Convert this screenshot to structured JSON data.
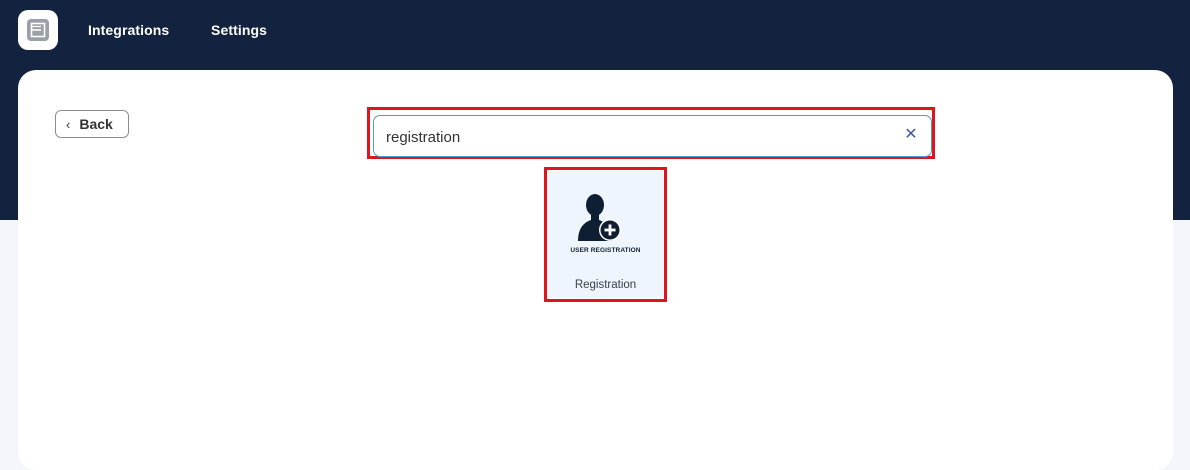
{
  "nav": {
    "integrations_label": "Integrations",
    "settings_label": "Settings"
  },
  "back_button": {
    "label": "Back"
  },
  "search": {
    "value": "registration",
    "clear_icon": "close-icon"
  },
  "results": [
    {
      "icon": "user-add-icon",
      "icon_caption": "USER REGISTRATION",
      "label": "Registration"
    }
  ],
  "colors": {
    "header_bg": "#13233f",
    "highlight": "#e0141b",
    "input_border": "#4a9fd8",
    "card_bg": "#eef5fc"
  }
}
